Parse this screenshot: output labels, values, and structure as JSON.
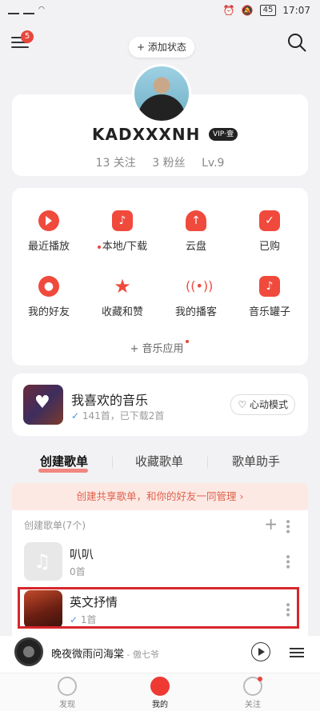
{
  "statusbar": {
    "time": "17:07",
    "battery": "45"
  },
  "header": {
    "badge_count": "5",
    "add_status_label": "+ 添加状态"
  },
  "profile": {
    "username": "KADXXXNH",
    "vip_label": "VIP·壹",
    "following": "13 关注",
    "followers": "3 粉丝",
    "level": "Lv.9"
  },
  "grid": {
    "items": [
      {
        "label": "最近播放",
        "icon": "play-icon"
      },
      {
        "label": "本地/下载",
        "icon": "download-icon"
      },
      {
        "label": "云盘",
        "icon": "cloud-icon"
      },
      {
        "label": "已购",
        "icon": "bag-icon"
      },
      {
        "label": "我的好友",
        "icon": "friends-icon"
      },
      {
        "label": "收藏和赞",
        "icon": "star-icon"
      },
      {
        "label": "我的播客",
        "icon": "podcast-icon"
      },
      {
        "label": "音乐罐子",
        "icon": "jar-icon"
      }
    ],
    "music_app_label": "+ 音乐应用"
  },
  "favorites": {
    "title": "我喜欢的音乐",
    "subtitle": "141首，已下载2首",
    "mode_label": "心动模式"
  },
  "tabs": [
    "创建歌单",
    "收藏歌单",
    "歌单助手"
  ],
  "shared_banner": "创建共享歌单，和你的好友一同管理 ›",
  "created_playlists": {
    "header": "创建歌单(7个)",
    "items": [
      {
        "name": "叭叭",
        "count": "0首"
      },
      {
        "name": "英文抒情",
        "count": "1首"
      }
    ]
  },
  "player": {
    "title": "晚夜微雨问海棠",
    "artist": " - 傲七爷"
  },
  "nav": [
    "发现",
    "我的",
    "关注"
  ],
  "colors": {
    "accent": "#ee3a33",
    "highlight_border": "#d8262b"
  }
}
